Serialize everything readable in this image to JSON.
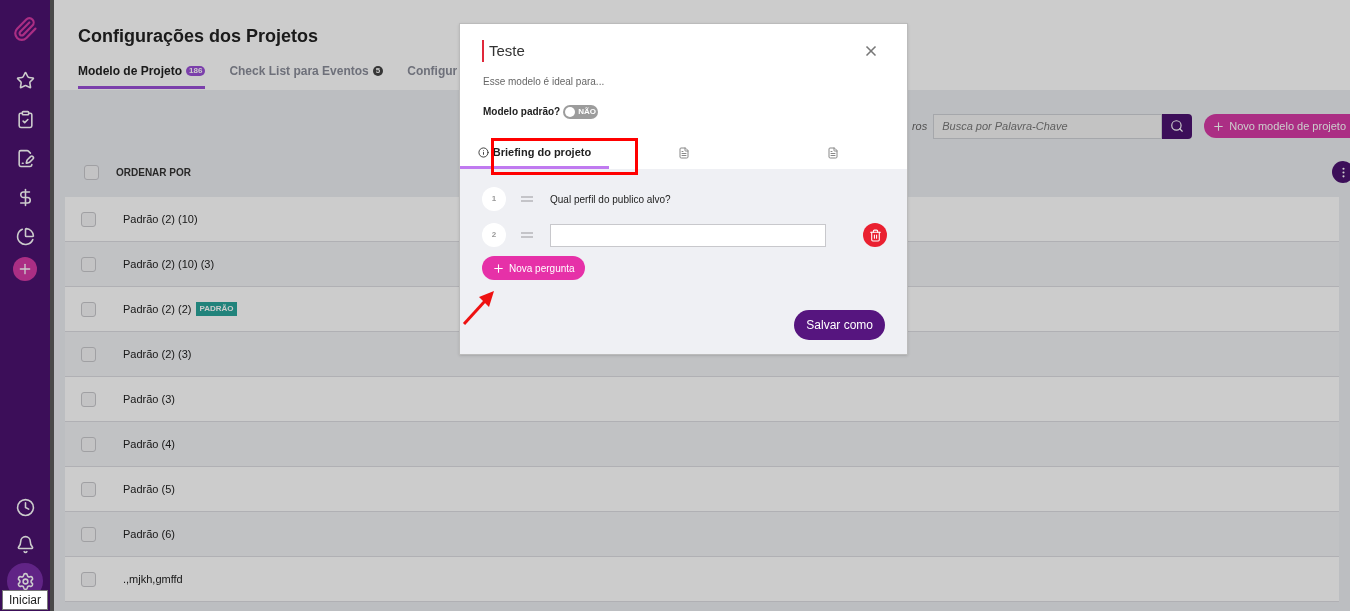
{
  "sidebar": {
    "items": [
      {
        "kind": "star",
        "selected": false
      },
      {
        "kind": "clipboard",
        "selected": false
      },
      {
        "kind": "edit",
        "selected": false
      },
      {
        "kind": "dollar",
        "selected": false
      },
      {
        "kind": "chart",
        "selected": false
      },
      {
        "kind": "add",
        "selected": false
      }
    ],
    "bottom_items": [
      {
        "kind": "clock",
        "selected": false
      },
      {
        "kind": "bell",
        "selected": false
      },
      {
        "kind": "settings",
        "selected": true
      }
    ],
    "tooltip": "Iniciar"
  },
  "page": {
    "title": "Configurações dos Projetos",
    "tabs": [
      {
        "label": "Modelo de Projeto",
        "count": "186",
        "selected": true
      },
      {
        "label": "Check List para Eventos",
        "count": "5",
        "selected": false
      },
      {
        "label": "Configur",
        "selected": false
      }
    ],
    "filter_label": "ros",
    "search": {
      "placeholder": "Busca por Palavra-Chave"
    },
    "new_button": "Novo modelo de projeto",
    "list_header": {
      "label": "ORDENAR POR",
      "checked": false
    },
    "rows": [
      {
        "name": "Padrão (2) (10)",
        "checked": false
      },
      {
        "name": "Padrão (2) (10) (3)",
        "checked": false
      },
      {
        "name": "Padrão (2) (2)",
        "badge": "PADRÃO",
        "checked": false
      },
      {
        "name": "Padrão (2) (3)",
        "checked": false
      },
      {
        "name": "Padrão (3)",
        "checked": false
      },
      {
        "name": "Padrão (4)",
        "checked": false
      },
      {
        "name": "Padrão (5)",
        "checked": false
      },
      {
        "name": "Padrão (6)",
        "checked": false
      },
      {
        "name": ".,mjkh,gmffd",
        "checked": false
      }
    ]
  },
  "modal": {
    "title": "Teste",
    "description": "Esse modelo é ideal para...",
    "default_model": {
      "label": "Modelo padrão?",
      "on": false,
      "state_text": "NÃO"
    },
    "tabs": [
      {
        "label": "Briefing do projeto",
        "selected": true
      },
      {
        "selected": false
      },
      {
        "selected": false
      }
    ],
    "questions": [
      {
        "number": "1",
        "kind": "text",
        "text": "Qual perfil do publico alvo?"
      },
      {
        "number": "2",
        "kind": "input"
      }
    ],
    "add_button": "Nova pergunta",
    "save_button": "Salvar como"
  }
}
